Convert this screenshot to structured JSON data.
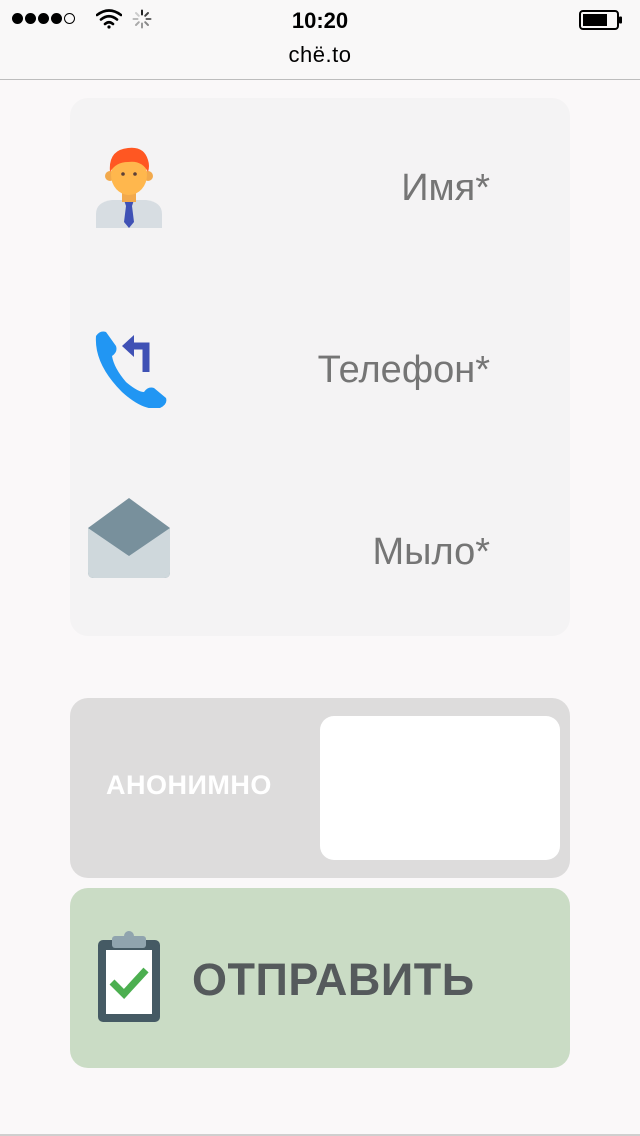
{
  "status_bar": {
    "time": "10:20",
    "url": "chë.to",
    "signal_bars_filled": 4,
    "signal_bars_total": 5,
    "battery_icon": "battery-icon",
    "wifi_icon": "wifi-icon",
    "loading_icon": "spinner-icon"
  },
  "form": {
    "fields": [
      {
        "icon": "person-icon",
        "placeholder": "Имя*",
        "value": ""
      },
      {
        "icon": "phone-callback-icon",
        "placeholder": "Телефон*",
        "value": ""
      },
      {
        "icon": "envelope-icon",
        "placeholder": "Мыло*",
        "value": ""
      }
    ]
  },
  "anonymous": {
    "label": "АНОНИМНО",
    "enabled": false
  },
  "submit": {
    "label": "ОТПРАВИТЬ",
    "icon": "clipboard-check-icon"
  },
  "colors": {
    "card": "#f4f3f4",
    "toggle_bg": "#dddcdc",
    "submit_bg": "#cadcc5",
    "submit_text": "#555a5c",
    "placeholder": "#757575"
  }
}
